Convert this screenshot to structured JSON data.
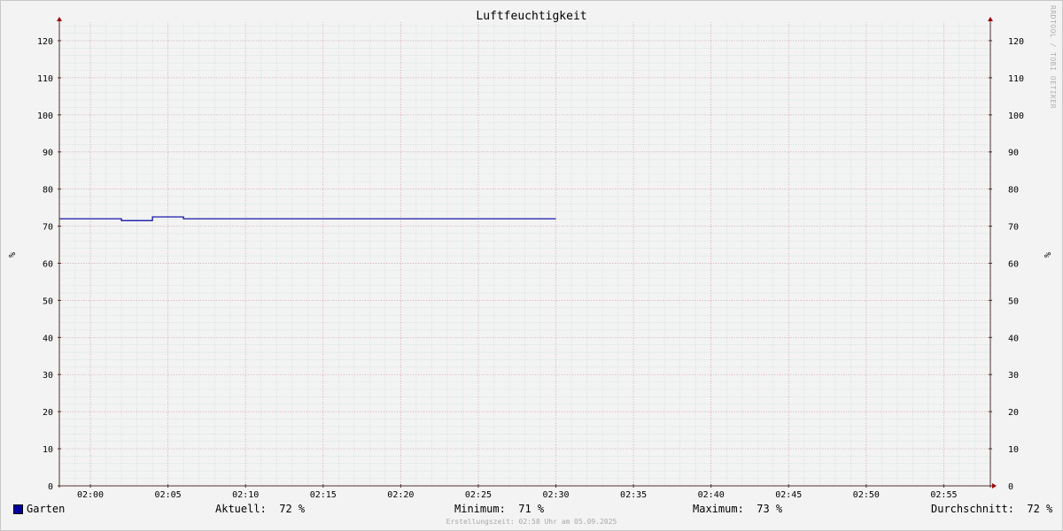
{
  "chart_data": {
    "type": "line",
    "title": "Luftfeuchtigkeit",
    "ylabel": "%",
    "ylabel_right": "%",
    "ylim": [
      0,
      125
    ],
    "yticks": [
      0,
      10,
      20,
      30,
      40,
      50,
      60,
      70,
      80,
      90,
      100,
      110,
      120
    ],
    "xlim": [
      "01:58",
      "02:58"
    ],
    "xticks": [
      "02:00",
      "02:05",
      "02:10",
      "02:15",
      "02:20",
      "02:25",
      "02:30",
      "02:35",
      "02:40",
      "02:45",
      "02:50",
      "02:55"
    ],
    "grid": true,
    "series": [
      {
        "name": "Garten",
        "color": "#0000a0",
        "x": [
          "01:58",
          "02:02",
          "02:02",
          "02:04",
          "02:04",
          "02:06",
          "02:06",
          "02:30"
        ],
        "y": [
          72,
          72,
          71.5,
          71.5,
          72.5,
          72.5,
          72,
          72
        ]
      }
    ],
    "grid_minor_color": "#c8dcdc",
    "grid_major_color": "#e8a0a8",
    "axis_color": "#503030"
  },
  "watermark": "RRDTOOL / TOBI OETIKER",
  "legend": {
    "series_label": "Garten",
    "aktuell": "Aktuell:  72 %",
    "minimum": "Minimum:  71 %",
    "maximum": "Maximum:  73 %",
    "durchschnitt": "Durchschnitt:  72 %"
  },
  "footer": "Erstellungszeit: 02:58 Uhr am 05.09.2025"
}
